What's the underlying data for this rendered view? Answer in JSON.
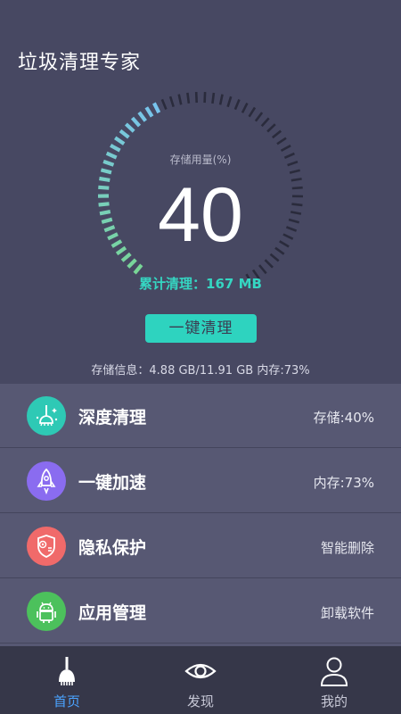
{
  "header": {
    "title": "垃圾清理专家"
  },
  "gauge": {
    "caption": "存储用量(%)",
    "value": "40",
    "percent": 40,
    "cleaned": "累计清理：167 MB"
  },
  "clean_button": {
    "label": "一键清理"
  },
  "storage_info": "存储信息：4.88 GB/11.91 GB    内存:73%",
  "menu": [
    {
      "label": "深度清理",
      "value": "存储:40%",
      "icon": "broom-sparkle-icon",
      "color": "#2ec9b5"
    },
    {
      "label": "一键加速",
      "value": "内存:73%",
      "icon": "rocket-icon",
      "color": "#8a6cf0"
    },
    {
      "label": "隐私保护",
      "value": "智能删除",
      "icon": "privacy-shield-icon",
      "color": "#f06a6a"
    },
    {
      "label": "应用管理",
      "value": "卸载软件",
      "icon": "android-icon",
      "color": "#4cc15c"
    }
  ],
  "tabs": [
    {
      "label": "首页",
      "icon": "broom-icon",
      "active": true
    },
    {
      "label": "发现",
      "icon": "eye-icon",
      "active": false
    },
    {
      "label": "我的",
      "icon": "person-icon",
      "active": false
    }
  ],
  "colors": {
    "background": "#474862",
    "accent": "#2ed3bf",
    "tab_active": "#4aa3ff"
  }
}
